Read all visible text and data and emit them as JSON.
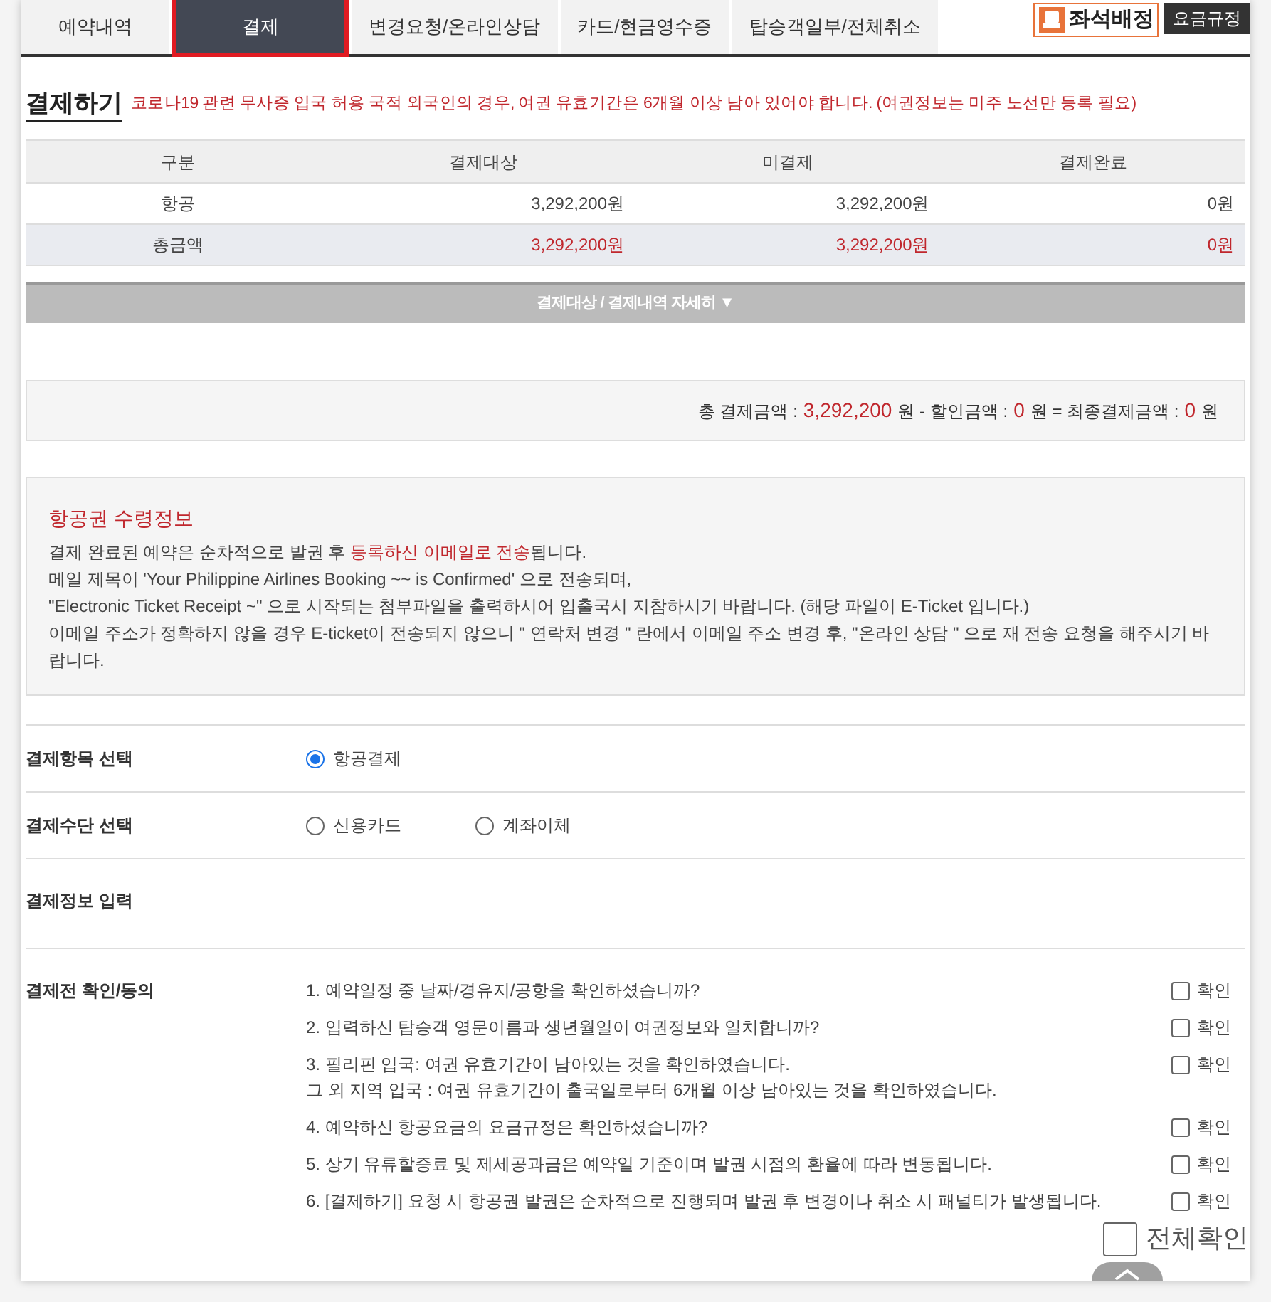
{
  "tabs": [
    {
      "label": "예약내역",
      "selected": false
    },
    {
      "label": "결제",
      "selected": true
    },
    {
      "label": "변경요청/온라인상담",
      "selected": false
    },
    {
      "label": "카드/현금영수증",
      "selected": false
    },
    {
      "label": "탑승객일부/전체취소",
      "selected": false
    }
  ],
  "seat_button": {
    "label": "좌석배정"
  },
  "fare_rules_button": {
    "label": "요금규정"
  },
  "title": "결제하기",
  "notice": "코로나19 관련 무사증 입국 허용 국적 외국인의 경우, 여권 유효기간은 6개월 이상 남아 있어야 합니다. (여권정보는 미주 노선만 등록 필요)",
  "table": {
    "columns": [
      "구분",
      "결제대상",
      "미결제",
      "결제완료"
    ],
    "rows": [
      {
        "kind": "normal",
        "cells": [
          "항공",
          "3,292,200원",
          "3,292,200원",
          "0원"
        ]
      },
      {
        "kind": "total",
        "cells": [
          "총금액",
          "3,292,200원",
          "3,292,200원",
          "0원"
        ]
      }
    ]
  },
  "details_toggle": {
    "label": "결제대상 / 결제내역 자세히 ▼"
  },
  "summary": [
    {
      "kind": "label",
      "text": "총 결제금액 :"
    },
    {
      "kind": "amount",
      "text": "3,292,200"
    },
    {
      "kind": "label",
      "text": "원 - 할인금액 :"
    },
    {
      "kind": "amount",
      "text": "0"
    },
    {
      "kind": "label",
      "text": "원 = 최종결제금액 :"
    },
    {
      "kind": "amount",
      "text": "0"
    },
    {
      "kind": "label",
      "text": "원"
    }
  ],
  "ticket_info": {
    "title": "항공권 수령정보",
    "lines": [
      "결제 완료된 예약은 순차적으로 발권 후 **등록하신 이메일로 전송**됩니다.",
      "메일 제목이 'Your Philippine Airlines Booking ~~ is Confirmed' 으로 전송되며,",
      "\"Electronic Ticket Receipt ~\" 으로 시작되는 첨부파일을 출력하시어 입출국시 지참하시기 바랍니다. (해당 파일이 E-Ticket 입니다.)",
      "이메일 주소가 정확하지 않을 경우 E-ticket이 전송되지 않으니  \" 연락처 변경 \" 란에서 이메일 주소 변경 후, \"온라인 상담 \" 으로 재 전송 요청을 해주시기 바랍니다."
    ]
  },
  "form": [
    {
      "label": "결제항목 선택",
      "options": [
        {
          "label": "항공결제",
          "selected": true
        }
      ]
    },
    {
      "label": "결제수단 선택",
      "options": [
        {
          "label": "신용카드",
          "selected": false
        },
        {
          "label": "계좌이체",
          "selected": false
        }
      ]
    },
    {
      "label": "결제정보 입력"
    }
  ],
  "agreement": {
    "label": "결제전 확인/동의",
    "items": [
      {
        "text": "1. 예약일정 중 날짜/경유지/공항을 확인하셨습니까?",
        "check_label": "확인",
        "checked": false
      },
      {
        "text": "2. 입력하신 탑승객 영문이름과 생년월일이 여권정보와 일치합니까?",
        "check_label": "확인",
        "checked": false
      },
      {
        "text": "3. 필리핀 입국: 여권 유효기간이 남아있는 것을 확인하였습니다.\n그 외 지역 입국 : 여권 유효기간이 출국일로부터 6개월 이상 남아있는 것을 확인하였습니다.",
        "check_label": "확인",
        "checked": false
      },
      {
        "text": "4. 예약하신 항공요금의 요금규정은 확인하셨습니까?",
        "check_label": "확인",
        "checked": false
      },
      {
        "text": "5. 상기 유류할증료 및 제세공과금은 예약일 기준이며 발권 시점의 환율에 따라 변동됩니다.",
        "check_label": "확인",
        "checked": false
      },
      {
        "text": "6. [결제하기] 요청 시 항공권 발권은 순차적으로 진행되며 발권 후 변경이나 취소 시 패널티가 발생됩니다.",
        "check_label": "확인",
        "checked": false
      }
    ],
    "check_all": {
      "label": "전체확인",
      "checked": false
    }
  }
}
